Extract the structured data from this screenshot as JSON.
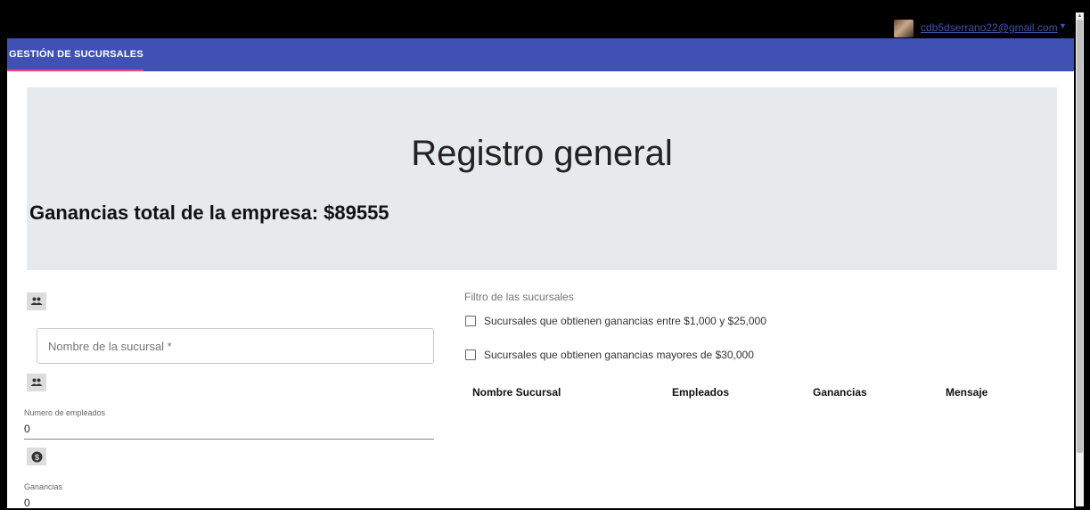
{
  "user": {
    "email": "cdb5dserrano22@gmail.com"
  },
  "nav": {
    "tab_label": "GESTIÓN DE SUCURSALES"
  },
  "hero": {
    "title": "Registro general",
    "subtitle": "Ganancias total de la empresa: $89555"
  },
  "form": {
    "name_placeholder": "Nombre de la sucursal *",
    "employees_label": "Numero de empleados",
    "employees_value": "0",
    "earnings_label": "Ganancias",
    "earnings_value": "0",
    "icons": [
      "people-icon",
      "people-icon",
      "dollar-icon"
    ]
  },
  "filters": {
    "title": "Filtro de las sucursales",
    "options": [
      {
        "label": "Sucursales que obtienen ganancias entre $1,000 y $25,000",
        "checked": false
      },
      {
        "label": "Sucursales que obtienen ganancias mayores de $30,000",
        "checked": false
      }
    ]
  },
  "table": {
    "headers": [
      "Nombre Sucursal",
      "Empleados",
      "Ganancias",
      "Mensaje"
    ],
    "rows": []
  },
  "colors": {
    "navbar": "#3f51b5",
    "tab_indicator": "#ff4081",
    "hero_bg": "#e7eaed"
  }
}
